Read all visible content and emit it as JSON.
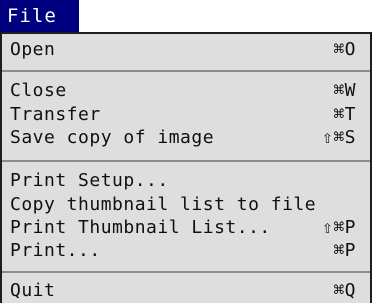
{
  "menubar": {
    "title": "File"
  },
  "menu": {
    "items": [
      {
        "label": "Open",
        "shortcut": "⌘O"
      },
      {
        "label": "Close",
        "shortcut": "⌘W"
      },
      {
        "label": "Transfer",
        "shortcut": "⌘T"
      },
      {
        "label": "Save copy of image",
        "shortcut": "⇧⌘S"
      },
      {
        "label": "Print Setup...",
        "shortcut": ""
      },
      {
        "label": "Copy thumbnail list to file",
        "shortcut": ""
      },
      {
        "label": "Print Thumbnail List...",
        "shortcut": "⇧⌘P"
      },
      {
        "label": "Print...",
        "shortcut": "⌘P"
      },
      {
        "label": "Quit",
        "shortcut": "⌘Q"
      }
    ]
  },
  "colors": {
    "menubar_highlight": "#00007f",
    "menu_background": "#dedede",
    "separator": "#8c8c8c"
  }
}
